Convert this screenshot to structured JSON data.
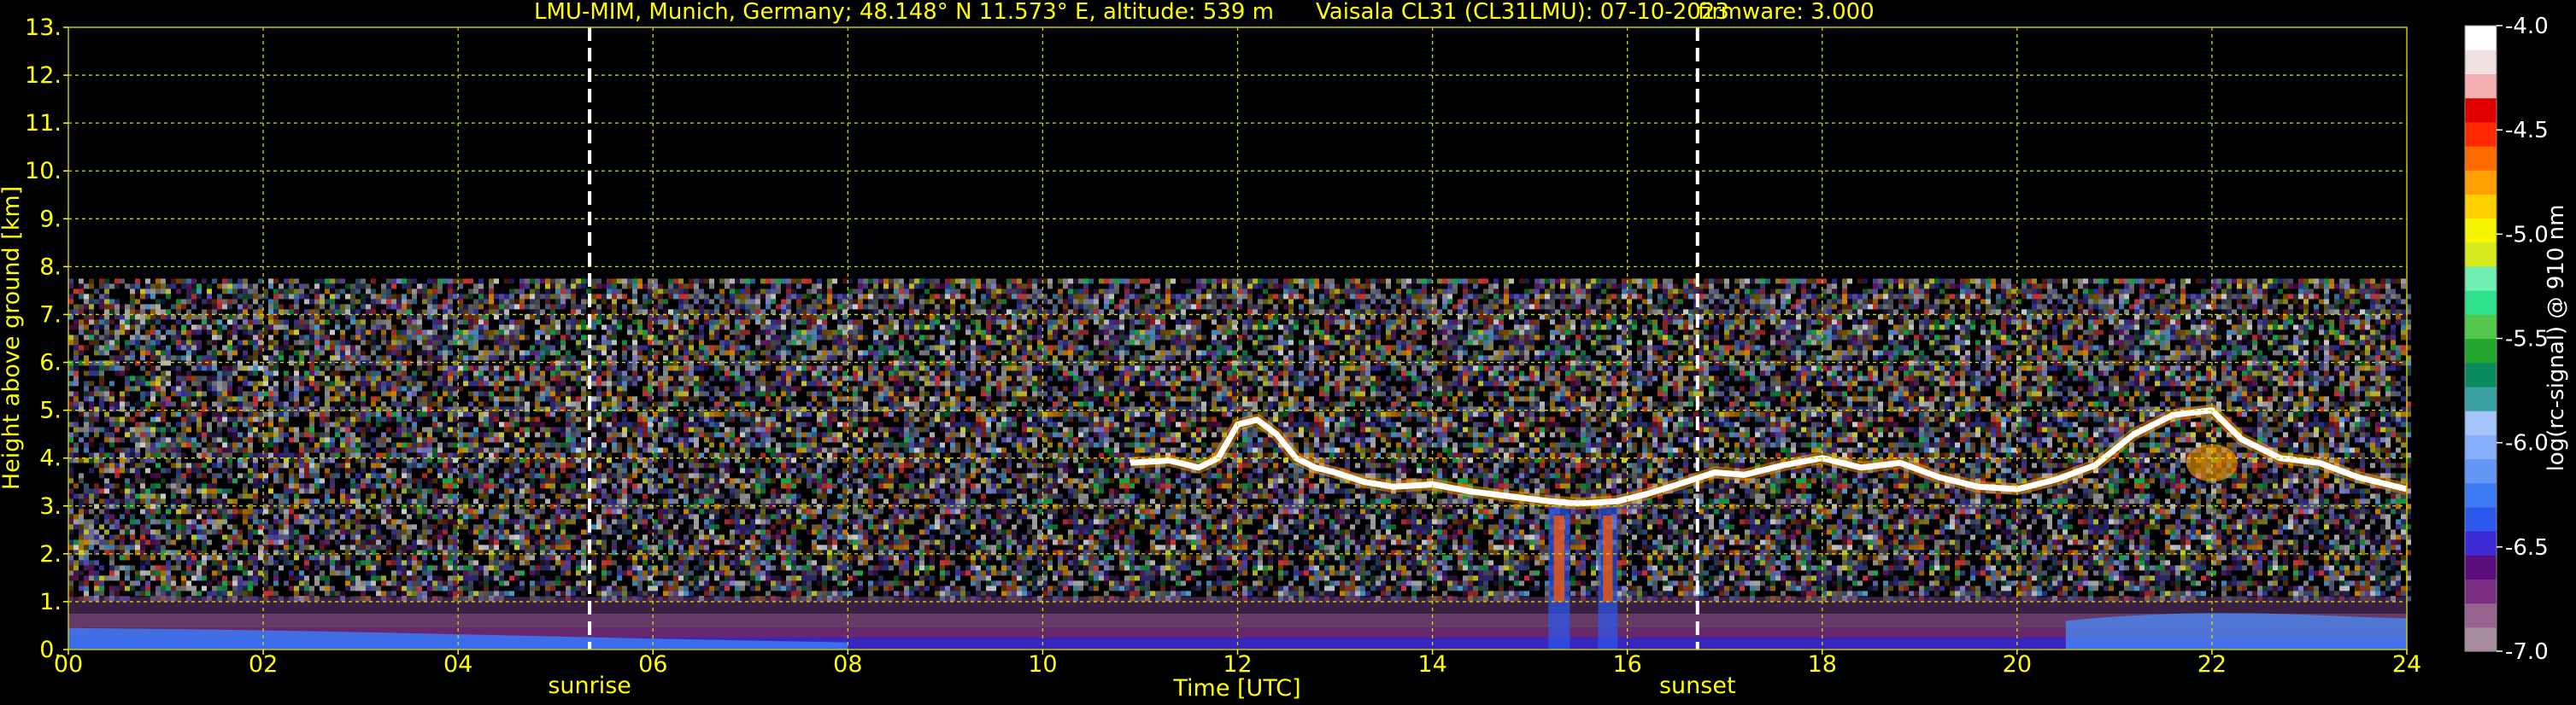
{
  "chart_data": {
    "type": "heatmap",
    "title_left": "LMU-MIM, Munich, Germany; 48.148° N 11.573° E, altitude: 539 m",
    "title_middle": "Vaisala CL31 (CL31LMU): 07-10-2023",
    "title_right": "firmware: 3.000",
    "xlabel": "Time [UTC]",
    "ylabel": "Height above ground [km]",
    "x_ticks": [
      "00",
      "02",
      "04",
      "06",
      "08",
      "10",
      "12",
      "14",
      "16",
      "18",
      "20",
      "22",
      "24"
    ],
    "x_range": [
      0,
      24
    ],
    "y_ticks": [
      "0.",
      "1.",
      "2.",
      "3.",
      "4.",
      "5.",
      "6.",
      "7.",
      "8.",
      "9.",
      "10.",
      "11.",
      "12.",
      "13."
    ],
    "y_range": [
      0,
      13
    ],
    "grid": true,
    "markers": [
      {
        "label": "sunrise",
        "time_h": 5.35
      },
      {
        "label": "sunset",
        "time_h": 16.72
      }
    ],
    "colorbar": {
      "label": "log(rc-signal) @ 910 nm",
      "ticks": [
        "-4.0",
        "-4.5",
        "-5.0",
        "-5.5",
        "-6.0",
        "-6.5",
        "-7.0"
      ],
      "range": [
        -7.0,
        -4.0
      ],
      "colors": [
        "#a88ea0",
        "#96638e",
        "#7a2f84",
        "#5c0d7e",
        "#3e2ad4",
        "#2c58ee",
        "#3c7af4",
        "#6496f8",
        "#86aefc",
        "#a6c4fc",
        "#3aa0a0",
        "#0a8a5e",
        "#22a82c",
        "#54c84c",
        "#2ee08a",
        "#6ff0b2",
        "#d6ea1e",
        "#f6f600",
        "#ffd000",
        "#ffa000",
        "#ff6a00",
        "#ff2a00",
        "#e00000",
        "#f4b0b0",
        "#f0e0e0",
        "#ffffff"
      ]
    },
    "layers": [
      {
        "name": "data-coverage-top",
        "height_km": 7.75
      },
      {
        "name": "boundary-layer",
        "height_km": [
          0,
          1.1
        ]
      },
      {
        "name": "cloud-layer",
        "time_h": [
          10.9,
          24
        ],
        "height_km": [
          3.3,
          5.1
        ]
      }
    ]
  }
}
